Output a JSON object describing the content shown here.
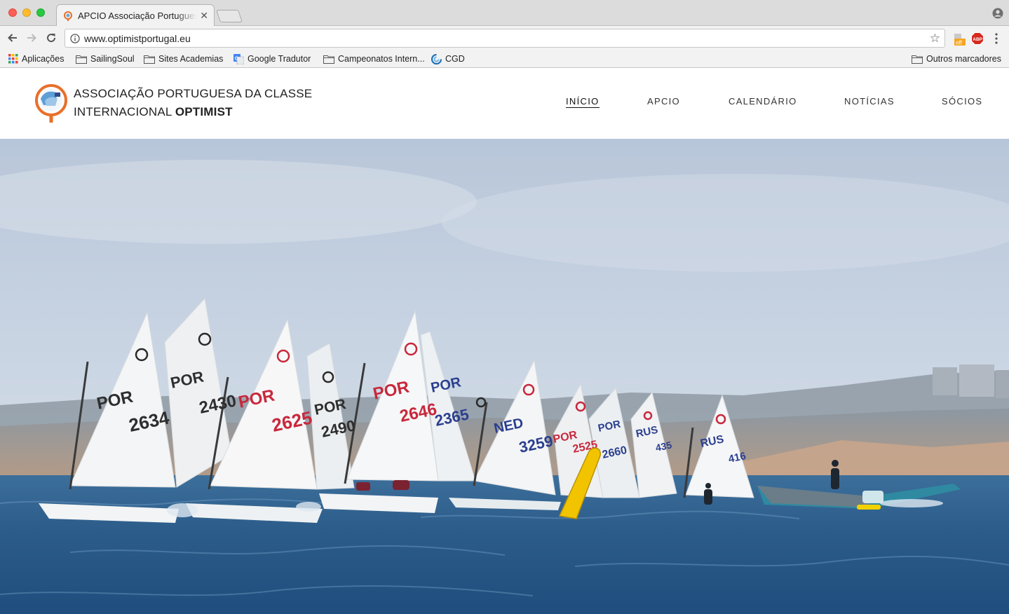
{
  "browser": {
    "tab_title": "APCIO Associação Portuguesa da Classe",
    "url": "www.optimistportugal.eu",
    "extensions": {
      "off_badge": "off",
      "abp_badge": "ABP"
    },
    "bookmarks": [
      {
        "label": "Aplicações",
        "icon": "apps-grid-icon"
      },
      {
        "label": "SailingSoul",
        "icon": "folder-icon"
      },
      {
        "label": "Sites Academias",
        "icon": "folder-icon"
      },
      {
        "label": "Google Tradutor",
        "icon": "google-translate-icon"
      },
      {
        "label": "Campeonatos Intern...",
        "icon": "folder-icon"
      },
      {
        "label": "CGD",
        "icon": "cgd-icon"
      }
    ],
    "other_bookmarks": "Outros marcadores"
  },
  "site": {
    "brand_line1": "ASSOCIAÇÃO PORTUGUESA DA CLASSE",
    "brand_line2_regular": "INTERNACIONAL",
    "brand_line2_bold": "OPTIMIST",
    "nav": [
      {
        "label": "INÍCIO",
        "active": true
      },
      {
        "label": "APCIO",
        "active": false
      },
      {
        "label": "CALENDÁRIO",
        "active": false
      },
      {
        "label": "NOTÍCIAS",
        "active": false
      },
      {
        "label": "SÓCIOS",
        "active": false
      }
    ],
    "colors": {
      "logo_orange": "#e8702a",
      "sky": "#b9c7d9",
      "sea": "#2f5f8c",
      "sail_red_text": "#c8283c",
      "sail_blue_text": "#2b3f8f"
    }
  },
  "hero": {
    "sail_numbers": [
      {
        "country": "POR",
        "number": "2634"
      },
      {
        "country": "POR",
        "number": "2430"
      },
      {
        "country": "POR",
        "number": "2625"
      },
      {
        "country": "POR",
        "number": "2490"
      },
      {
        "country": "POR",
        "number": "2646"
      },
      {
        "country": "POR",
        "number": "2365"
      },
      {
        "country": "NED",
        "number": "3259"
      },
      {
        "country": "POR",
        "number": "2525"
      },
      {
        "country": "POR",
        "number": "2660"
      },
      {
        "country": "RUS",
        "number": "435"
      },
      {
        "country": "RUS",
        "number": "416"
      }
    ]
  }
}
